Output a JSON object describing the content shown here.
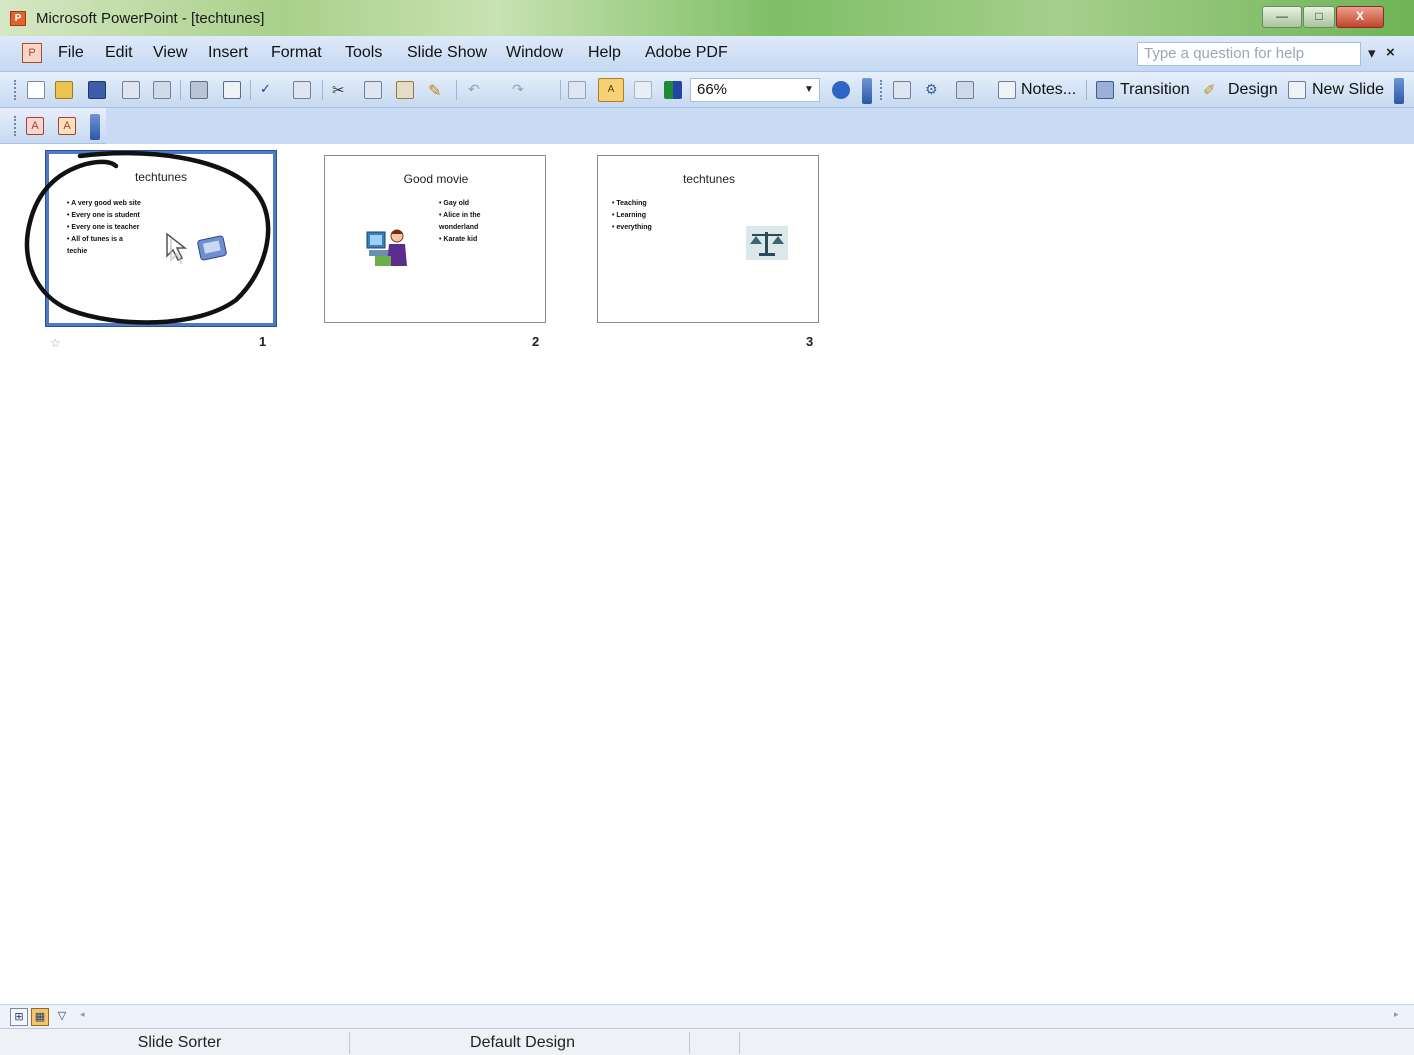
{
  "window": {
    "title": "Microsoft PowerPoint - [techtunes]",
    "app_icon": "powerpoint-icon",
    "minimize_label": "—",
    "maximize_label": "□",
    "close_label": "X"
  },
  "menu": {
    "items": [
      "File",
      "Edit",
      "View",
      "Insert",
      "Format",
      "Tools",
      "Slide Show",
      "Window",
      "Help",
      "Adobe PDF"
    ],
    "help_placeholder": "Type a question for help",
    "help_dropdown": "▾",
    "close_doc": "×"
  },
  "toolbar": {
    "zoom": "66%",
    "notes_label": "Notes...",
    "transition_label": "Transition",
    "design_label": "Design",
    "new_slide_label": "New Slide"
  },
  "slides": [
    {
      "number": "1",
      "title": "techtunes",
      "bullets": [
        "A very good web site",
        "Every one is student",
        "Every one is teacher",
        "All of tunes is a techie"
      ],
      "selected": true
    },
    {
      "number": "2",
      "title": "Good movie",
      "bullets": [
        "Gay old",
        "Alice in the wonderland",
        "Karate kid"
      ],
      "selected": false
    },
    {
      "number": "3",
      "title": "techtunes",
      "bullets": [
        "Teaching",
        "Learning",
        "everything"
      ],
      "selected": false
    }
  ],
  "status": {
    "view": "Slide Sorter",
    "design": "Default Design"
  },
  "colors": {
    "selection": "#4e79c4",
    "titlebar_green": "#7fbf66",
    "toolbar_blue": "#c6d9f1"
  }
}
